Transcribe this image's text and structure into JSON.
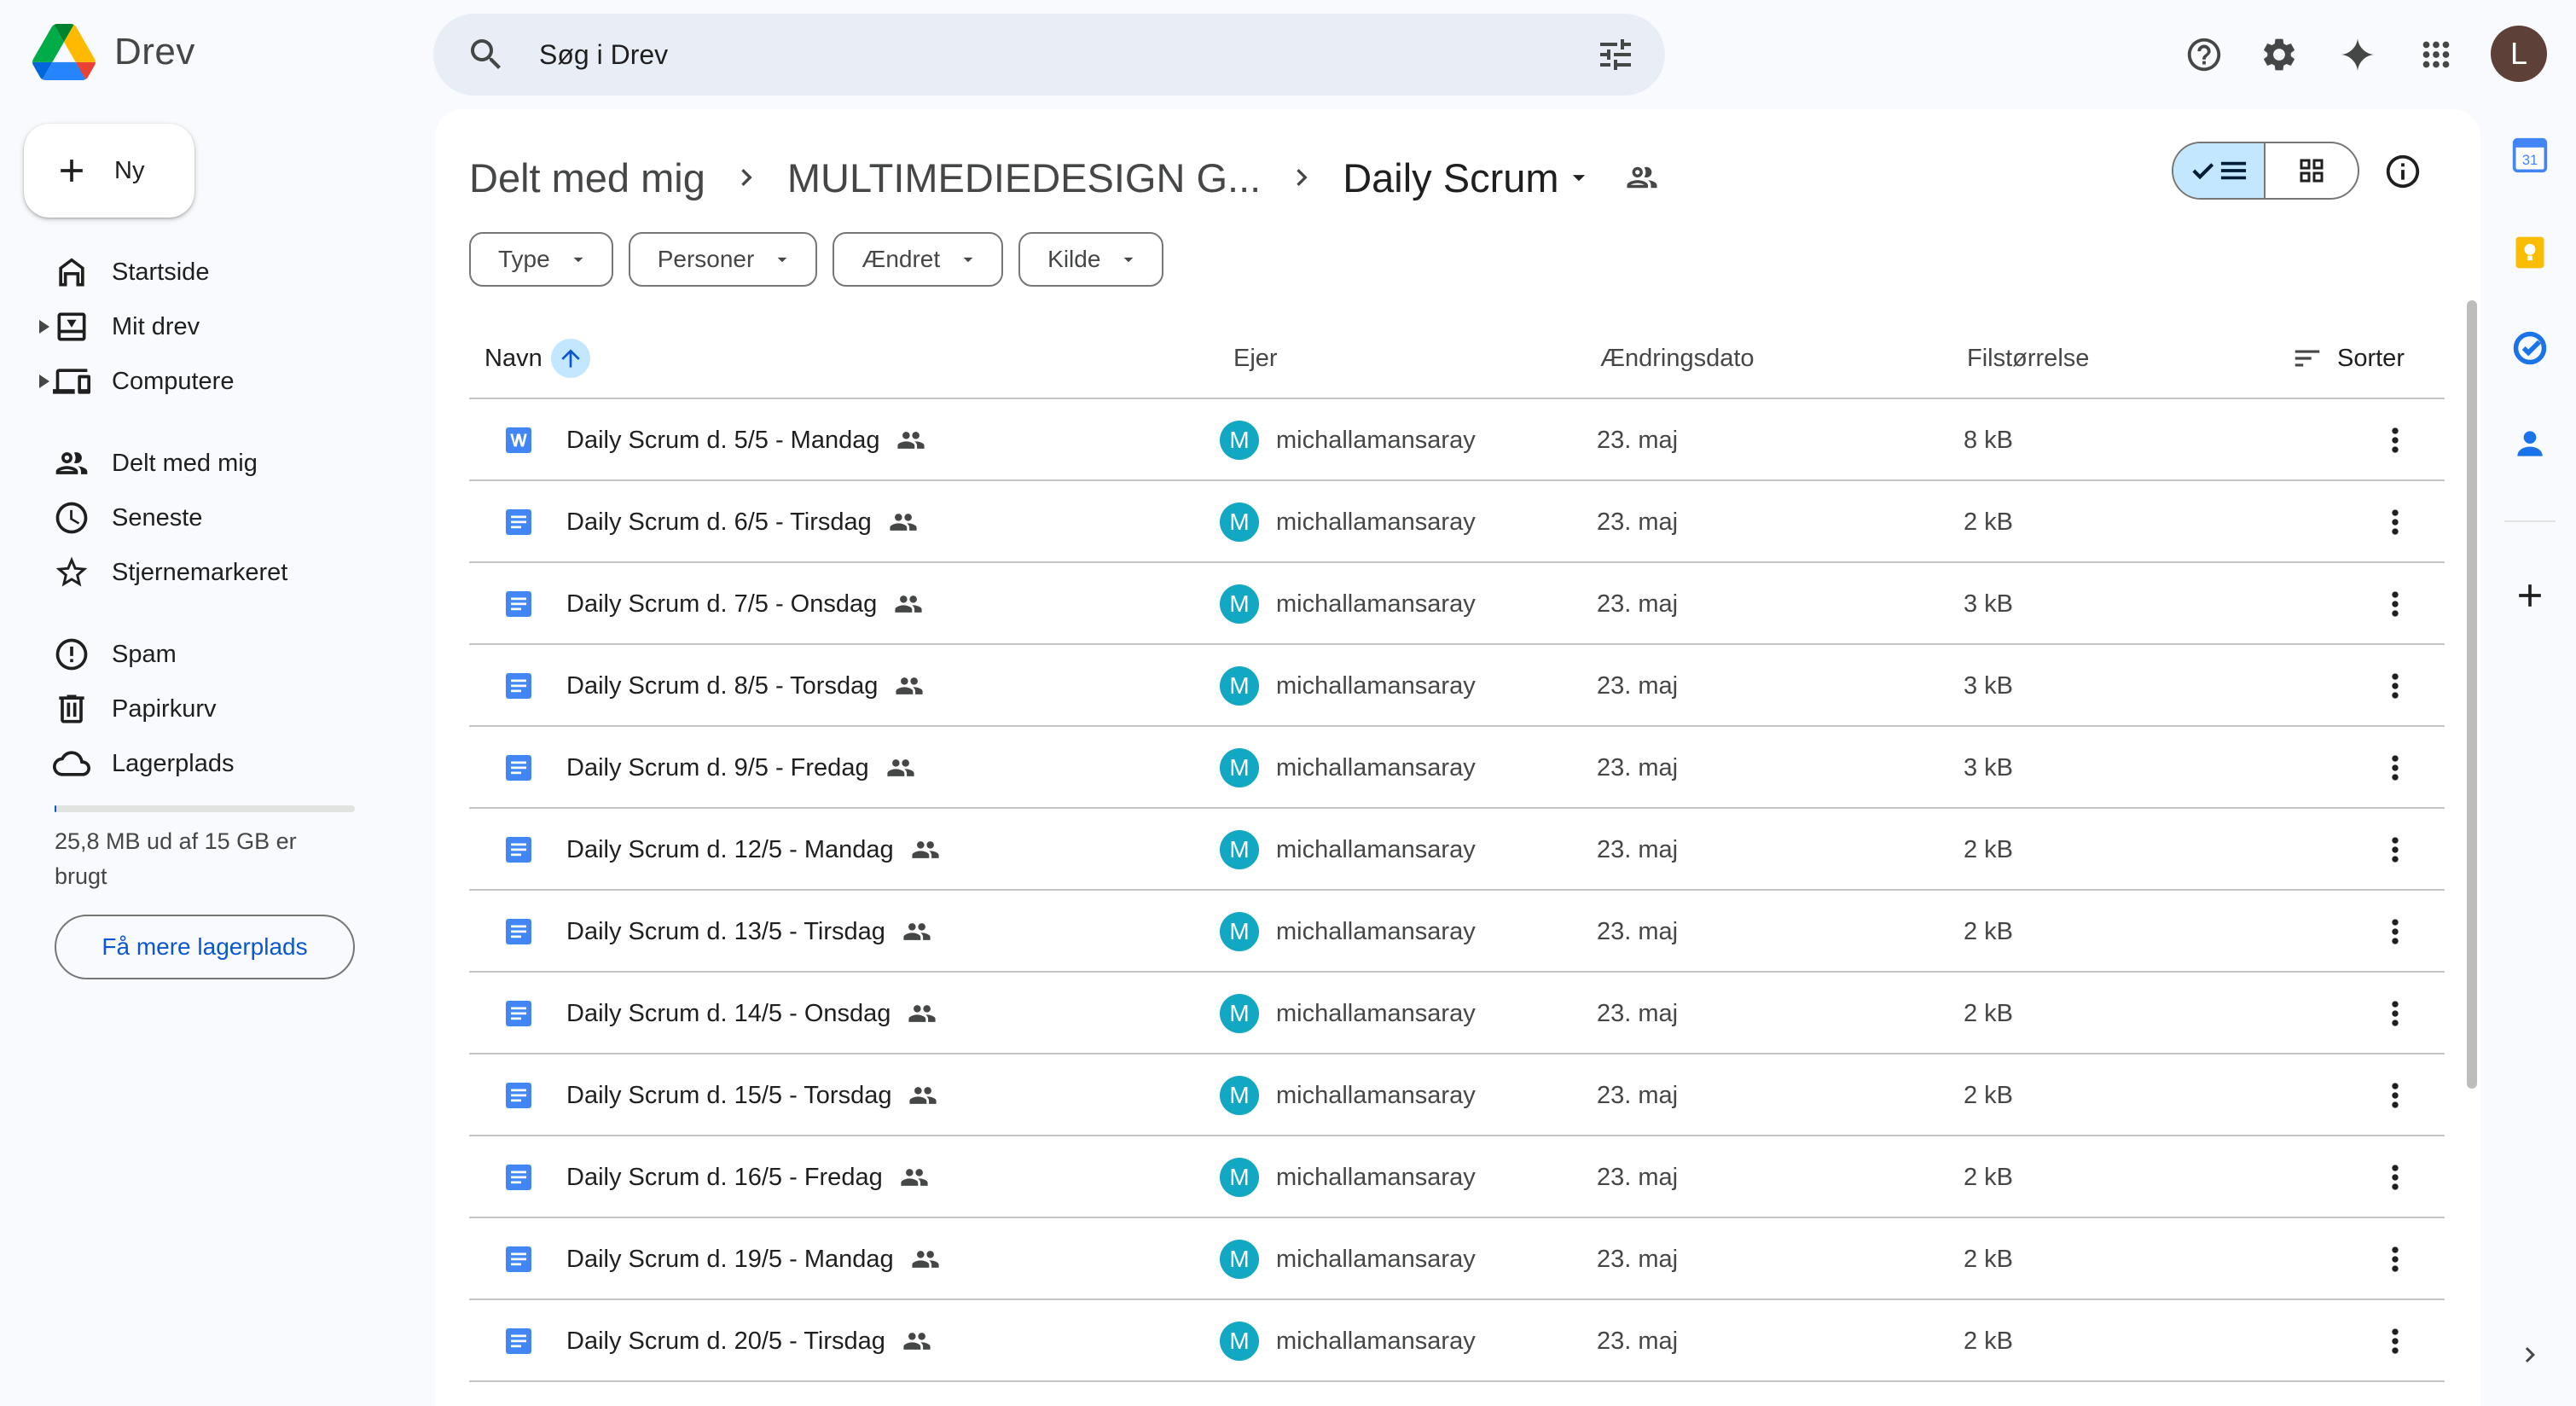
{
  "app": {
    "name": "Drev"
  },
  "search": {
    "placeholder": "Søg i Drev"
  },
  "header": {
    "avatar_letter": "L"
  },
  "new_button": {
    "label": "Ny"
  },
  "sidebar": {
    "items": [
      {
        "label": "Startside",
        "icon": "home-icon"
      },
      {
        "label": "Mit drev",
        "icon": "my-drive-icon"
      },
      {
        "label": "Computere",
        "icon": "computers-icon"
      },
      {
        "label": "Delt med mig",
        "icon": "shared-people-icon"
      },
      {
        "label": "Seneste",
        "icon": "clock-icon"
      },
      {
        "label": "Stjernemarkeret",
        "icon": "star-icon"
      },
      {
        "label": "Spam",
        "icon": "spam-icon"
      },
      {
        "label": "Papirkurv",
        "icon": "trash-icon"
      },
      {
        "label": "Lagerplads",
        "icon": "cloud-icon"
      }
    ],
    "storage_used_fraction": 0.002,
    "storage_text": "25,8 MB ud af 15 GB er brugt",
    "more_storage_label": "Få mere lagerplads"
  },
  "breadcrumb": {
    "items": [
      "Delt med mig",
      "MULTIMEDIEDESIGN G..."
    ],
    "current": "Daily Scrum"
  },
  "filters": [
    "Type",
    "Personer",
    "Ændret",
    "Kilde"
  ],
  "table": {
    "headers": {
      "name": "Navn",
      "owner": "Ejer",
      "modified": "Ændringsdato",
      "size": "Filstørrelse",
      "sort": "Sorter"
    },
    "rows": [
      {
        "name": "Daily Scrum d. 5/5 - Mandag",
        "type": "word",
        "owner_initial": "M",
        "owner": "michallamansaray",
        "modified": "23. maj",
        "size": "8 kB"
      },
      {
        "name": "Daily Scrum d. 6/5 - Tirsdag",
        "type": "doc",
        "owner_initial": "M",
        "owner": "michallamansaray",
        "modified": "23. maj",
        "size": "2 kB"
      },
      {
        "name": "Daily Scrum d. 7/5 - Onsdag",
        "type": "doc",
        "owner_initial": "M",
        "owner": "michallamansaray",
        "modified": "23. maj",
        "size": "3 kB"
      },
      {
        "name": "Daily Scrum d. 8/5 - Torsdag",
        "type": "doc",
        "owner_initial": "M",
        "owner": "michallamansaray",
        "modified": "23. maj",
        "size": "3 kB"
      },
      {
        "name": "Daily Scrum d. 9/5 - Fredag",
        "type": "doc",
        "owner_initial": "M",
        "owner": "michallamansaray",
        "modified": "23. maj",
        "size": "3 kB"
      },
      {
        "name": "Daily Scrum d. 12/5 - Mandag",
        "type": "doc",
        "owner_initial": "M",
        "owner": "michallamansaray",
        "modified": "23. maj",
        "size": "2 kB"
      },
      {
        "name": "Daily Scrum d. 13/5 - Tirsdag",
        "type": "doc",
        "owner_initial": "M",
        "owner": "michallamansaray",
        "modified": "23. maj",
        "size": "2 kB"
      },
      {
        "name": "Daily Scrum d. 14/5 - Onsdag",
        "type": "doc",
        "owner_initial": "M",
        "owner": "michallamansaray",
        "modified": "23. maj",
        "size": "2 kB"
      },
      {
        "name": "Daily Scrum d. 15/5 - Torsdag",
        "type": "doc",
        "owner_initial": "M",
        "owner": "michallamansaray",
        "modified": "23. maj",
        "size": "2 kB"
      },
      {
        "name": "Daily Scrum d. 16/5 - Fredag",
        "type": "doc",
        "owner_initial": "M",
        "owner": "michallamansaray",
        "modified": "23. maj",
        "size": "2 kB"
      },
      {
        "name": "Daily Scrum d. 19/5 - Mandag",
        "type": "doc",
        "owner_initial": "M",
        "owner": "michallamansaray",
        "modified": "23. maj",
        "size": "2 kB"
      },
      {
        "name": "Daily Scrum d. 20/5 - Tirsdag",
        "type": "doc",
        "owner_initial": "M",
        "owner": "michallamansaray",
        "modified": "23. maj",
        "size": "2 kB"
      }
    ]
  },
  "colors": {
    "accent": "#0b57d0",
    "selected": "#c2e7ff",
    "doc_blue": "#4285f4",
    "owner_avatar": "#12a8c4",
    "background": "#f8fafd"
  }
}
